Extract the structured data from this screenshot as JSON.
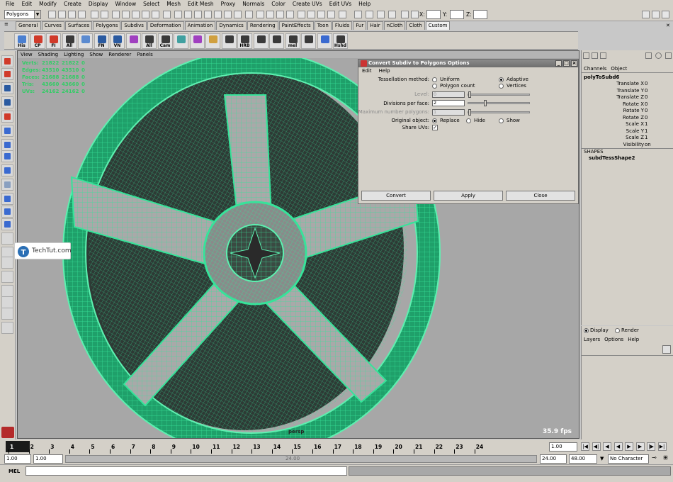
{
  "menubar": {
    "items": [
      "File",
      "Edit",
      "Modify",
      "Create",
      "Display",
      "Window",
      "Select",
      "Mesh",
      "Edit Mesh",
      "Proxy",
      "Normals",
      "Color",
      "Create UVs",
      "Edit UVs",
      "Help"
    ]
  },
  "status": {
    "mode": "Polygons",
    "x_label": "X:",
    "y_label": "Y:",
    "z_label": "Z:"
  },
  "shelf": {
    "tabs": [
      "General",
      "Curves",
      "Surfaces",
      "Polygons",
      "Subdivs",
      "Deformation",
      "Animation",
      "Dynamics",
      "Rendering",
      "PaintEffects",
      "Toon",
      "Fluids",
      "Fur",
      "Hair",
      "nCloth",
      "Cloth",
      "Custom"
    ],
    "active_tab": "Custom",
    "icons": [
      "His",
      "CP",
      "FI",
      "All",
      "",
      "FN",
      "VN",
      "",
      "All",
      "Cam",
      "",
      "",
      "",
      "",
      "HRB",
      "",
      "",
      "mel",
      "",
      "",
      "Hshd"
    ]
  },
  "viewport": {
    "menu": [
      "View",
      "Shading",
      "Lighting",
      "Show",
      "Renderer",
      "Panels"
    ],
    "hud": [
      {
        "label": "Verts:",
        "v1": "21822",
        "v2": "21822",
        "v3": "0"
      },
      {
        "label": "Edges:",
        "v1": "43510",
        "v2": "43510",
        "v3": "0"
      },
      {
        "label": "Faces:",
        "v1": "21688",
        "v2": "21688",
        "v3": "0"
      },
      {
        "label": "Tris:",
        "v1": "43660",
        "v2": "43660",
        "v3": "0"
      },
      {
        "label": "UVs:",
        "v1": "24162",
        "v2": "24162",
        "v3": "0"
      }
    ],
    "camera": "persp",
    "fps": "35.9 fps",
    "wire_color": "#37e39a"
  },
  "watermark": {
    "text": "TechTut.com"
  },
  "dialog": {
    "title": "Convert Subdiv to Polygons Options",
    "menu": [
      "Edit",
      "Help"
    ],
    "tessellation_label": "Tessellation method:",
    "opt_uniform": "Uniform",
    "opt_adaptive": "Adaptive",
    "opt_polycount": "Polygon count",
    "opt_vertices": "Vertices",
    "level_label": "Level:",
    "level_value": "0",
    "divisions_label": "Divisions per face:",
    "divisions_value": "2",
    "maxpoly_label": "Maximum number polygons:",
    "maxpoly_value": "1",
    "original_label": "Original object:",
    "opt_replace": "Replace",
    "opt_hide": "Hide",
    "opt_show": "Show",
    "shareuvs_label": "Share UVs:",
    "convert_label": "Convert",
    "apply_label": "Apply",
    "close_label": "Close"
  },
  "channelbox": {
    "menu": [
      "Channels",
      "Object"
    ],
    "node": "polyToSubd6",
    "channels": [
      {
        "label": "Translate X",
        "value": "0"
      },
      {
        "label": "Translate Y",
        "value": "0"
      },
      {
        "label": "Translate Z",
        "value": "0"
      },
      {
        "label": "Rotate X",
        "value": "0"
      },
      {
        "label": "Rotate Y",
        "value": "0"
      },
      {
        "label": "Rotate Z",
        "value": "0"
      },
      {
        "label": "Scale X",
        "value": "1"
      },
      {
        "label": "Scale Y",
        "value": "1"
      },
      {
        "label": "Scale Z",
        "value": "1"
      },
      {
        "label": "Visibility",
        "value": "on"
      }
    ],
    "shapes_label": "SHAPES",
    "shape_node": "subdTessShape2"
  },
  "layers": {
    "display_label": "Display",
    "render_label": "Render",
    "menu": [
      "Layers",
      "Options",
      "Help"
    ]
  },
  "timeline": {
    "ticks": [
      "1",
      "2",
      "3",
      "4",
      "5",
      "6",
      "7",
      "8",
      "9",
      "10",
      "11",
      "12",
      "13",
      "14",
      "15",
      "16",
      "17",
      "18",
      "19",
      "20",
      "21",
      "22",
      "23",
      "24"
    ],
    "current_frame": "1.00"
  },
  "range": {
    "start": "1.00",
    "inner_start": "1.00",
    "inner_end_label": "24.00",
    "end": "24.00",
    "total_end": "48.00",
    "character_set": "No Character Set"
  },
  "command": {
    "label": "MEL"
  }
}
